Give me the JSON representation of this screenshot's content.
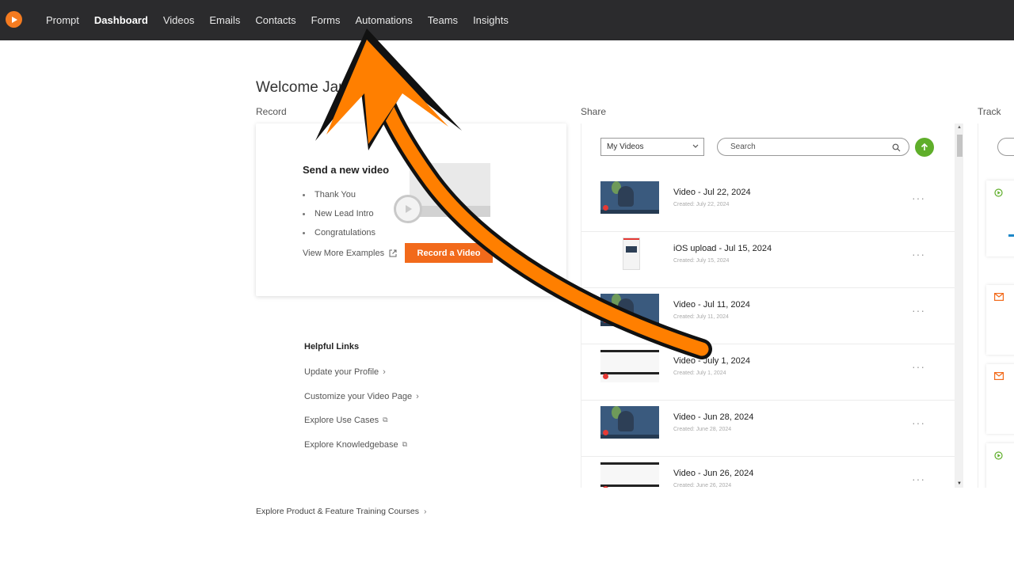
{
  "nav": {
    "items": [
      {
        "label": "Prompt",
        "active": false
      },
      {
        "label": "Dashboard",
        "active": true
      },
      {
        "label": "Videos",
        "active": false
      },
      {
        "label": "Emails",
        "active": false
      },
      {
        "label": "Contacts",
        "active": false
      },
      {
        "label": "Forms",
        "active": false
      },
      {
        "label": "Automations",
        "active": false
      },
      {
        "label": "Teams",
        "active": false
      },
      {
        "label": "Insights",
        "active": false
      }
    ]
  },
  "welcome": "Welcome Jam",
  "record": {
    "section_label": "Record",
    "title": "Send a new video",
    "examples": [
      "Thank You",
      "New Lead Intro",
      "Congratulations"
    ],
    "view_more": "View More Examples",
    "button": "Record a Video"
  },
  "helpful": {
    "title": "Helpful Links",
    "links": [
      {
        "label": "Update your Profile",
        "icon": "chevron-right-icon"
      },
      {
        "label": "Customize your Video Page",
        "icon": "chevron-right-icon"
      },
      {
        "label": "Explore Use Cases",
        "icon": "external-link-icon"
      },
      {
        "label": "Explore Knowledgebase",
        "icon": "external-link-icon"
      }
    ]
  },
  "training": "Explore Product & Feature Training Courses",
  "share": {
    "section_label": "Share",
    "filter_value": "My Videos",
    "search_placeholder": "Search",
    "videos": [
      {
        "title": "Video - Jul 22, 2024",
        "created": "Created: July 22, 2024",
        "thumb": "webcam"
      },
      {
        "title": "iOS upload - Jul 15, 2024",
        "created": "Created: July 15, 2024",
        "thumb": "phone"
      },
      {
        "title": "Video - Jul 11, 2024",
        "created": "Created: July 11, 2024",
        "thumb": "webcam"
      },
      {
        "title": "Video - July 1, 2024",
        "created": "Created: July 1, 2024",
        "thumb": "screen"
      },
      {
        "title": "Video - Jun 28, 2024",
        "created": "Created: June 28, 2024",
        "thumb": "webcam"
      },
      {
        "title": "Video - Jun 26, 2024",
        "created": "Created: June 26, 2024",
        "thumb": "screen"
      }
    ]
  },
  "track": {
    "section_label": "Track"
  },
  "colors": {
    "nav_bg": "#2b2b2d",
    "brand_orange": "#f47b20",
    "record_button": "#f26a1b",
    "upload_green": "#5fae2a",
    "annotation_arrow": "#ff7f00"
  }
}
